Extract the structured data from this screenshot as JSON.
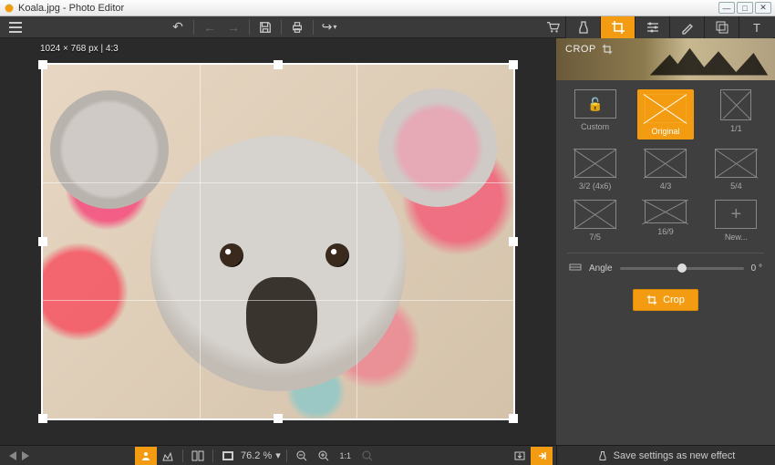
{
  "title": "Koala.jpg - Photo Editor",
  "colors": {
    "accent": "#f39c12"
  },
  "canvas": {
    "dim_label": "1024 × 768 px | 4:3"
  },
  "panel": {
    "header": "CROP",
    "ratios": [
      {
        "label": "Custom"
      },
      {
        "label": "Original"
      },
      {
        "label": "1/1"
      },
      {
        "label": "3/2 (4x6)"
      },
      {
        "label": "4/3"
      },
      {
        "label": "5/4"
      },
      {
        "label": "7/5"
      },
      {
        "label": "16/9"
      },
      {
        "label": "New..."
      }
    ],
    "angle_label": "Angle",
    "angle_value": "0 °",
    "crop_button": "Crop"
  },
  "bottom": {
    "zoom": "76.2 %",
    "save_effect": "Save settings as new effect"
  }
}
